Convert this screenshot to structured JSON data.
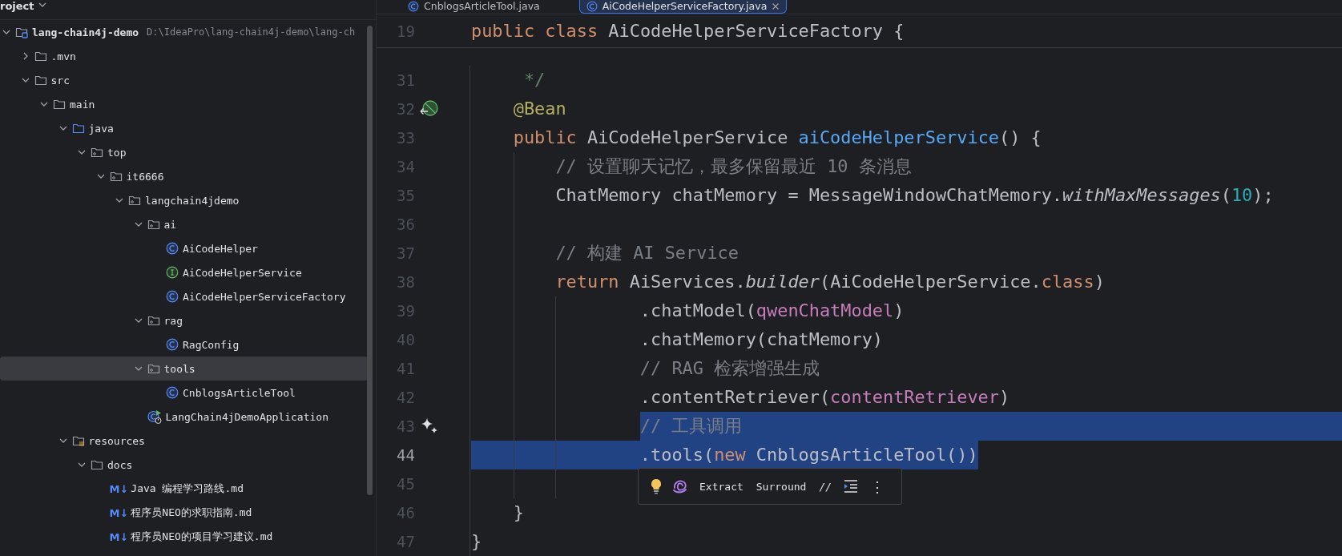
{
  "project_panel": {
    "title": "roject",
    "tree": [
      {
        "label": "lang-chain4j-demo",
        "kind": "module",
        "path": "D:\\IdeaPro\\lang-chain4j-demo\\lang-ch",
        "expanded": true,
        "selected": false,
        "children": [
          {
            "label": ".mvn",
            "kind": "folder",
            "expanded": false,
            "selected": false
          },
          {
            "label": "src",
            "kind": "folder",
            "expanded": true,
            "selected": false,
            "children": [
              {
                "label": "main",
                "kind": "folder",
                "expanded": true,
                "selected": false,
                "children": [
                  {
                    "label": "java",
                    "kind": "source",
                    "expanded": true,
                    "selected": false,
                    "children": [
                      {
                        "label": "top",
                        "kind": "package",
                        "expanded": true,
                        "selected": false,
                        "children": [
                          {
                            "label": "it6666",
                            "kind": "package",
                            "expanded": true,
                            "selected": false,
                            "children": [
                              {
                                "label": "langchain4jdemo",
                                "kind": "package",
                                "expanded": true,
                                "selected": false,
                                "children": [
                                  {
                                    "label": "ai",
                                    "kind": "package",
                                    "expanded": true,
                                    "selected": false,
                                    "children": [
                                      {
                                        "label": "AiCodeHelper",
                                        "kind": "class",
                                        "selected": false
                                      },
                                      {
                                        "label": "AiCodeHelperService",
                                        "kind": "interface",
                                        "selected": false
                                      },
                                      {
                                        "label": "AiCodeHelperServiceFactory",
                                        "kind": "class",
                                        "selected": false
                                      }
                                    ]
                                  },
                                  {
                                    "label": "rag",
                                    "kind": "package",
                                    "expanded": true,
                                    "selected": false,
                                    "children": [
                                      {
                                        "label": "RagConfig",
                                        "kind": "class",
                                        "selected": false
                                      }
                                    ]
                                  },
                                  {
                                    "label": "tools",
                                    "kind": "package",
                                    "expanded": true,
                                    "selected": true,
                                    "children": [
                                      {
                                        "label": "CnblogsArticleTool",
                                        "kind": "class",
                                        "selected": false
                                      }
                                    ]
                                  },
                                  {
                                    "label": "LangChain4jDemoApplication",
                                    "kind": "app",
                                    "selected": false
                                  }
                                ]
                              }
                            ]
                          }
                        ]
                      }
                    ]
                  },
                  {
                    "label": "resources",
                    "kind": "resources",
                    "expanded": true,
                    "selected": false,
                    "children": [
                      {
                        "label": "docs",
                        "kind": "folder",
                        "expanded": true,
                        "selected": false,
                        "children": [
                          {
                            "label": "Java 编程学习路线.md",
                            "kind": "markdown",
                            "icon_text": "M↓",
                            "selected": false
                          },
                          {
                            "label": "程序员NEO的求职指南.md",
                            "kind": "markdown",
                            "icon_text": "M↓",
                            "selected": false
                          },
                          {
                            "label": "程序员NEO的项目学习建议.md",
                            "kind": "markdown",
                            "icon_text": "M↓",
                            "selected": false
                          }
                        ]
                      }
                    ]
                  }
                ]
              }
            ]
          }
        ]
      }
    ]
  },
  "tabs": [
    {
      "label": "CnblogsArticleTool.java",
      "selected": false
    },
    {
      "label": "AiCodeHelperServiceFactory.java",
      "selected": true
    }
  ],
  "editor": {
    "sticky_line": {
      "number": "19",
      "tokens": [
        {
          "text": "public class ",
          "kind": "keyword"
        },
        {
          "text": "AiCodeHelperServiceFactory {",
          "kind": "plain"
        }
      ]
    },
    "lines": [
      {
        "number": "31",
        "selected": false,
        "current": false,
        "tokens": [
          {
            "text": "     */",
            "kind": "doc"
          }
        ]
      },
      {
        "number": "32",
        "selected": false,
        "current": false,
        "gutter_icon": {
          "kind": "bean"
        },
        "tokens": [
          {
            "text": "    @Bean",
            "kind": "annotation"
          }
        ]
      },
      {
        "number": "33",
        "selected": false,
        "current": false,
        "tokens": [
          {
            "text": "    public ",
            "kind": "keyword"
          },
          {
            "text": "AiCodeHelperService ",
            "kind": "plain"
          },
          {
            "text": "aiCodeHelperService",
            "kind": "method"
          },
          {
            "text": "() {",
            "kind": "plain"
          }
        ]
      },
      {
        "number": "34",
        "selected": false,
        "current": false,
        "tokens": [
          {
            "text": "        // 设置聊天记忆，最多保留最近 10 条消息",
            "kind": "comment"
          }
        ]
      },
      {
        "number": "35",
        "selected": false,
        "current": false,
        "tokens": [
          {
            "text": "        ChatMemory chatMemory = MessageWindowChatMemory.",
            "kind": "plain"
          },
          {
            "text": "withMaxMessages",
            "kind": "static"
          },
          {
            "text": "(",
            "kind": "plain"
          },
          {
            "text": "10",
            "kind": "number"
          },
          {
            "text": ");",
            "kind": "plain"
          }
        ]
      },
      {
        "number": "36",
        "selected": false,
        "current": false
      },
      {
        "number": "37",
        "selected": false,
        "current": false,
        "tokens": [
          {
            "text": "        // 构建 AI Service",
            "kind": "comment"
          }
        ]
      },
      {
        "number": "38",
        "selected": false,
        "current": false,
        "tokens": [
          {
            "text": "        return ",
            "kind": "keyword"
          },
          {
            "text": "AiServices.",
            "kind": "plain"
          },
          {
            "text": "builder",
            "kind": "static"
          },
          {
            "text": "(AiCodeHelperService.",
            "kind": "plain"
          },
          {
            "text": "class",
            "kind": "keyword"
          },
          {
            "text": ")",
            "kind": "plain"
          }
        ]
      },
      {
        "number": "39",
        "selected": false,
        "current": false,
        "tokens": [
          {
            "text": "                .chatModel(",
            "kind": "plain"
          },
          {
            "text": "qwenChatModel",
            "kind": "field"
          },
          {
            "text": ")",
            "kind": "plain"
          }
        ]
      },
      {
        "number": "40",
        "selected": false,
        "current": false,
        "tokens": [
          {
            "text": "                .chatMemory(chatMemory)",
            "kind": "plain"
          }
        ]
      },
      {
        "number": "41",
        "selected": false,
        "current": false,
        "tokens": [
          {
            "text": "                // RAG 检索增强生成",
            "kind": "comment"
          }
        ]
      },
      {
        "number": "42",
        "selected": false,
        "current": false,
        "tokens": [
          {
            "text": "                .contentRetriever(",
            "kind": "plain"
          },
          {
            "text": "contentRetriever",
            "kind": "field"
          },
          {
            "text": ")",
            "kind": "plain"
          }
        ]
      },
      {
        "number": "43",
        "selected": true,
        "current": false,
        "gutter_icon": {
          "kind": "ai"
        },
        "tokens": [
          {
            "text": "                // 工具调用",
            "kind": "comment"
          }
        ]
      },
      {
        "number": "44",
        "selected": true,
        "current": true,
        "tokens": [
          {
            "text": "                .tools(",
            "kind": "plain"
          },
          {
            "text": "new ",
            "kind": "keyword"
          },
          {
            "text": "CnblogsArticleTool())",
            "kind": "plain"
          }
        ]
      },
      {
        "number": "45",
        "selected": false,
        "current": false
      },
      {
        "number": "46",
        "selected": false,
        "current": false,
        "tokens": [
          {
            "text": "    }",
            "kind": "plain"
          }
        ]
      },
      {
        "number": "47",
        "selected": false,
        "current": false,
        "tokens": [
          {
            "text": "}",
            "kind": "plain"
          }
        ]
      }
    ]
  },
  "popup": {
    "actions": [
      {
        "kind": "bulb"
      },
      {
        "kind": "ai"
      },
      {
        "kind": "action",
        "label": "Extract"
      },
      {
        "kind": "action",
        "label": "Surround"
      },
      {
        "kind": "comment",
        "label": "//"
      },
      {
        "kind": "reformat"
      },
      {
        "kind": "more",
        "label": "⋮"
      }
    ]
  }
}
